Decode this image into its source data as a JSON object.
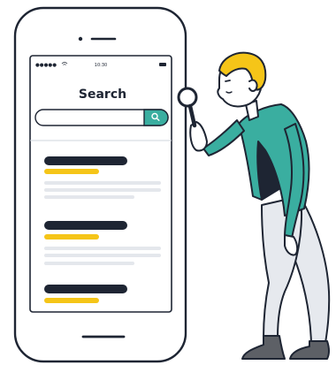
{
  "status_bar": {
    "signal": "●●●●●",
    "time": "10:30"
  },
  "screen": {
    "title": "Search",
    "search_icon": "search-icon"
  },
  "icons": {
    "magnifier": "magnifying-glass-icon"
  },
  "colors": {
    "outline": "#1e2533",
    "accent_teal": "#3aaea0",
    "accent_yellow": "#f5c518",
    "hair_yellow": "#f5c518",
    "placeholder_gray": "#e4e7ec",
    "divider_gray": "#cfd5dd",
    "pants_gray": "#e6e9ee"
  }
}
